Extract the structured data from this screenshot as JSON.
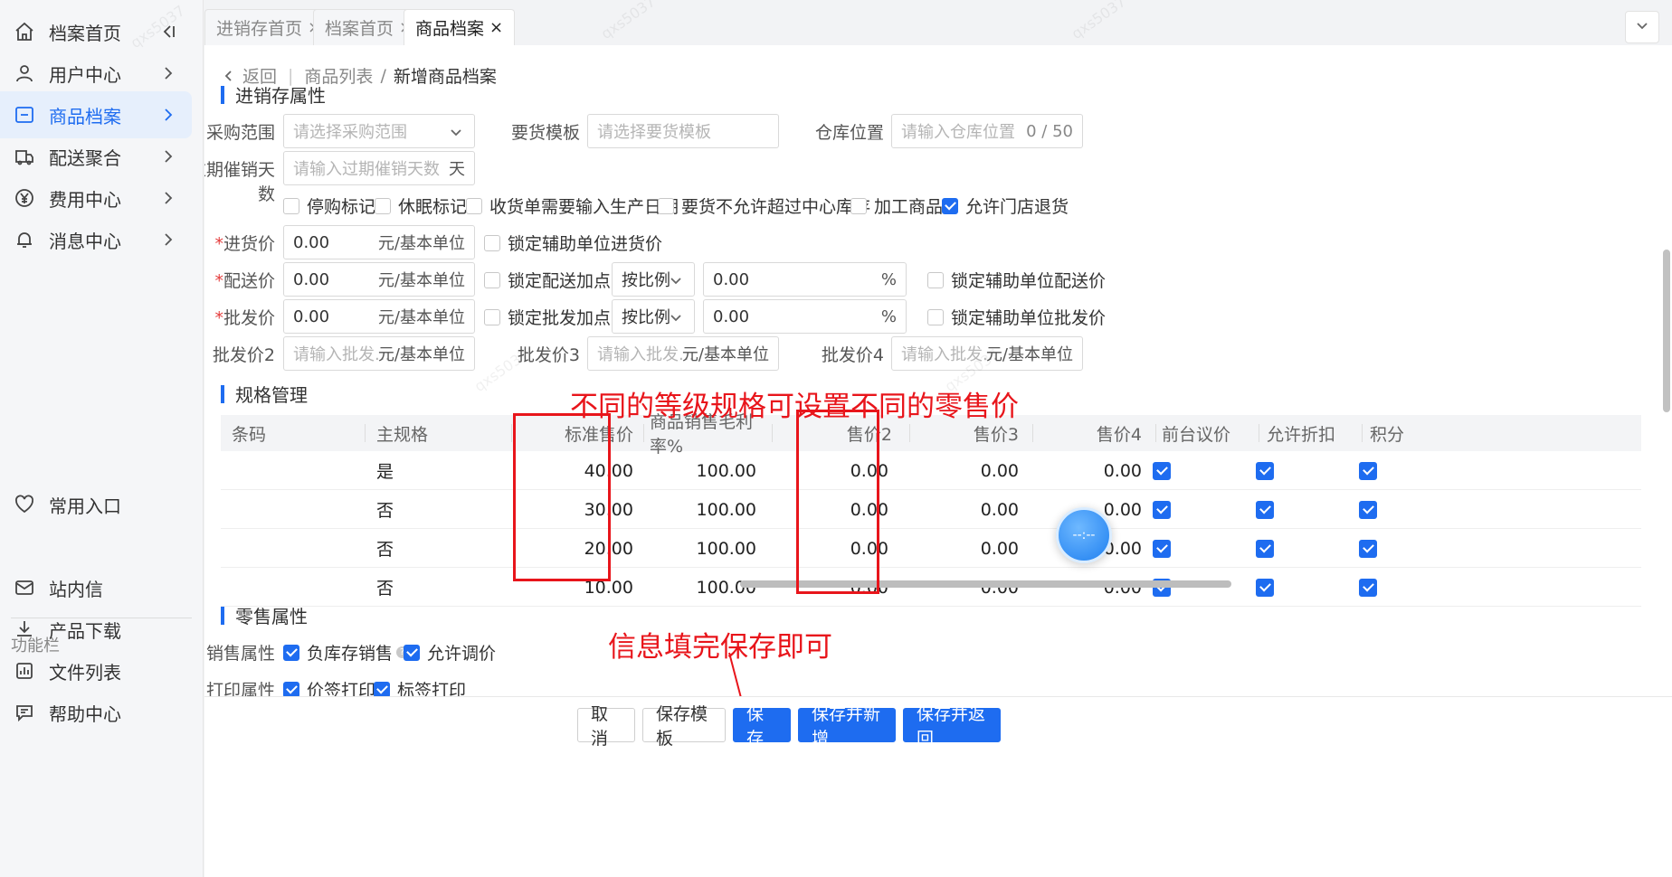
{
  "sidebar": {
    "items": [
      {
        "label": "档案首页",
        "icon": "home-icon"
      },
      {
        "label": "用户中心",
        "icon": "user-icon"
      },
      {
        "label": "商品档案",
        "icon": "goods-icon"
      },
      {
        "label": "配送聚合",
        "icon": "delivery-icon"
      },
      {
        "label": "费用中心",
        "icon": "yen-icon"
      },
      {
        "label": "消息中心",
        "icon": "bell-icon"
      }
    ],
    "favorite": "常用入口",
    "section_label": "功能栏",
    "tools": [
      "站内信",
      "产品下载",
      "文件列表",
      "帮助中心"
    ]
  },
  "tabs": [
    {
      "label": "进销存首页"
    },
    {
      "label": "档案首页"
    },
    {
      "label": "商品档案"
    }
  ],
  "breadcrumb": {
    "back": "返回",
    "parent": "商品列表",
    "current": "新增商品档案"
  },
  "sections": {
    "inventory": "进销存属性",
    "spec": "规格管理",
    "retail": "零售属性"
  },
  "form": {
    "purchase_scope": {
      "label": "采购范围",
      "placeholder": "请选择采购范围"
    },
    "order_template": {
      "label": "要货模板",
      "placeholder": "请选择要货模板"
    },
    "warehouse": {
      "label": "仓库位置",
      "placeholder": "请输入仓库位置",
      "counter": "0 / 50"
    },
    "expiry_days": {
      "label": "过期催销天数",
      "placeholder": "请输入过期催销天数",
      "suffix": "天"
    },
    "flags": [
      {
        "label": "停购标记",
        "checked": false
      },
      {
        "label": "休眠标记",
        "checked": false
      },
      {
        "label": "收货单需要输入生产日期",
        "checked": false
      },
      {
        "label": "要货不允许超过中心库存",
        "checked": false
      },
      {
        "label": "加工商品",
        "checked": false
      },
      {
        "label": "允许门店退货",
        "checked": true
      }
    ],
    "purchase_price": {
      "label": "进货价",
      "value": "0.00",
      "suffix": "元/基本单位",
      "lock": "锁定辅助单位进货价"
    },
    "delivery_price": {
      "label": "配送价",
      "value": "0.00",
      "suffix": "元/基本单位",
      "lock_markup": "锁定配送加点",
      "mode": "按比例",
      "pct": "0.00",
      "pct_suffix": "%",
      "lock_aux": "锁定辅助单位配送价"
    },
    "wholesale_price": {
      "label": "批发价",
      "value": "0.00",
      "suffix": "元/基本单位",
      "lock_markup": "锁定批发加点",
      "mode": "按比例",
      "pct": "0.00",
      "pct_suffix": "%",
      "lock_aux": "锁定辅助单位批发价"
    },
    "wholesale2": {
      "label": "批发价2",
      "placeholder": "请输入批发...",
      "suffix": "元/基本单位"
    },
    "wholesale3": {
      "label": "批发价3",
      "placeholder": "请输入批发...",
      "suffix": "元/基本单位"
    },
    "wholesale4": {
      "label": "批发价4",
      "placeholder": "请输入批发...",
      "suffix": "元/基本单位"
    }
  },
  "spec_table": {
    "headers": [
      "条码",
      "主规格",
      "标准售价",
      "商品销售毛利率%",
      "售价2",
      "售价3",
      "售价4",
      "前台议价",
      "允许折扣",
      "积分"
    ],
    "rows": [
      {
        "barcode": "",
        "main": "是",
        "std": "40.00",
        "margin": "100.00",
        "p2": "0.00",
        "p3": "0.00",
        "p4": "0.00",
        "bargain": true,
        "discount": true,
        "points": true
      },
      {
        "barcode": "",
        "main": "否",
        "std": "30.00",
        "margin": "100.00",
        "p2": "0.00",
        "p3": "0.00",
        "p4": "0.00",
        "bargain": true,
        "discount": true,
        "points": true
      },
      {
        "barcode": "",
        "main": "否",
        "std": "20.00",
        "margin": "100.00",
        "p2": "0.00",
        "p3": "0.00",
        "p4": "0.00",
        "bargain": true,
        "discount": true,
        "points": true
      },
      {
        "barcode": "",
        "main": "否",
        "std": "10.00",
        "margin": "100.00",
        "p2": "0.00",
        "p3": "0.00",
        "p4": "0.00",
        "bargain": true,
        "discount": true,
        "points": true
      }
    ]
  },
  "retail": {
    "sales_label": "销售属性",
    "sales_opts": [
      {
        "label": "负库存销售",
        "checked": true
      },
      {
        "label": "允许调价",
        "checked": true
      }
    ],
    "print_label": "打印属性",
    "print_opts": [
      {
        "label": "价签打印",
        "checked": true
      },
      {
        "label": "标签打印",
        "checked": true
      }
    ]
  },
  "annotations": {
    "top": "不同的等级规格可设置不同的零售价",
    "bottom": "信息填完保存即可"
  },
  "buttons": {
    "cancel": "取 消",
    "save_template": "保存模板",
    "save": "保 存",
    "save_new": "保存并新增",
    "save_back": "保存并返回"
  },
  "assistant": "--:--",
  "watermark": "qxs5037",
  "colors": {
    "primary": "#1e6cf0",
    "annotation": "#e8151b",
    "required": "#e43d3d"
  }
}
